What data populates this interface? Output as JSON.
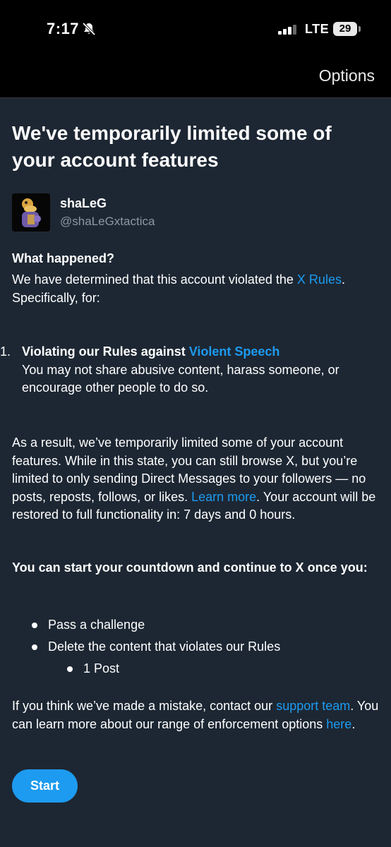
{
  "status_bar": {
    "time": "7:17",
    "network": "LTE",
    "battery": "29"
  },
  "nav": {
    "options_label": "Options"
  },
  "page": {
    "title": "We've temporarily limited some of your account features",
    "profile": {
      "display_name": "shaLeG",
      "handle": "@shaLeGxtactica"
    },
    "what_happened_heading": "What happened?",
    "what_happened_text_before": "We have determined that this account violated the ",
    "rules_link": "X Rules",
    "what_happened_text_after": ". Specifically, for:",
    "violations": [
      {
        "number": "1.",
        "title_before": "Violating our Rules against ",
        "title_link": "Violent Speech",
        "description": "You may not share abusive content, harass someone, or encourage other people to do so."
      }
    ],
    "result_text_before": "As a result, we’ve temporarily limited some of your account features. While in this state, you can still browse X, but you’re limited to only sending Direct Messages to your followers — no posts, reposts, follows, or likes. ",
    "learn_more_link": "Learn more",
    "result_text_after": ". Your account will be restored to full functionality in: 7 days and 0 hours.",
    "countdown_heading": "You can start your countdown and continue to X once you:",
    "steps": [
      "Pass a challenge",
      "Delete the content that violates our Rules"
    ],
    "sub_steps": [
      "1 Post"
    ],
    "mistake_text_before": "If you think we’ve made a mistake, contact our ",
    "support_link": "support team",
    "mistake_text_middle": ". You can learn more about our range of enforcement options ",
    "here_link": "here",
    "mistake_text_after": ".",
    "start_button": "Start"
  },
  "colors": {
    "background": "#1d2733",
    "link": "#1d9bf0",
    "button": "#1d9bf0",
    "secondary_text": "#8b98a5"
  },
  "icons": [
    "bell-slash-icon",
    "signal-icon",
    "battery-icon"
  ]
}
